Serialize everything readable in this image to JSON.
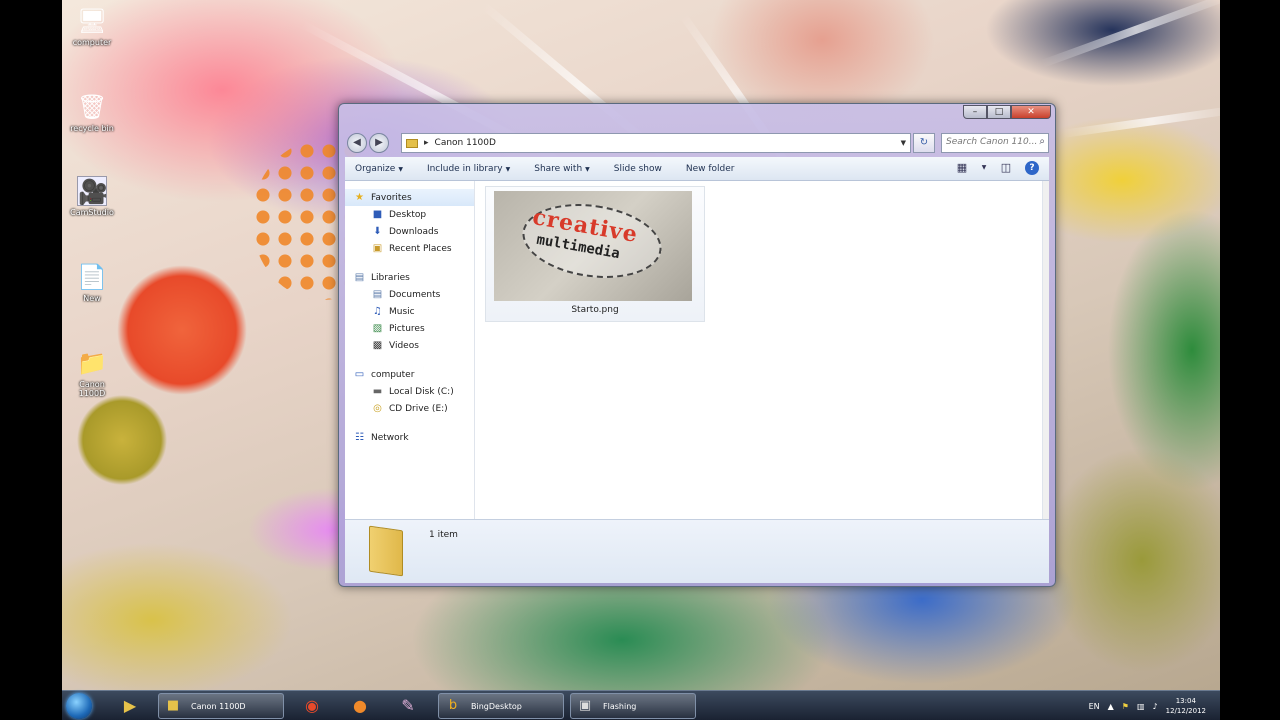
{
  "desktop": {
    "icons": [
      {
        "label": "computer",
        "icon": "computer-icon"
      },
      {
        "label": "recycle bin",
        "icon": "recycle-bin-icon"
      },
      {
        "label": "CamStudio",
        "icon": "camstudio-icon"
      },
      {
        "label": "New",
        "icon": "file-icon"
      },
      {
        "label": "Canon 1100D",
        "icon": "folder-icon"
      }
    ]
  },
  "window": {
    "address": {
      "path": "Canon 1100D"
    },
    "search": {
      "placeholder": "Search Canon 110..."
    },
    "toolbar": {
      "organize": "Organize",
      "include_in_library": "Include in library",
      "share_with": "Share with",
      "slide_show": "Slide show",
      "new_folder": "New folder"
    },
    "nav": {
      "favorites": "Favorites",
      "desktop": "Desktop",
      "downloads": "Downloads",
      "recent_places": "Recent Places",
      "libraries": "Libraries",
      "documents": "Documents",
      "music": "Music",
      "pictures": "Pictures",
      "videos": "Videos",
      "computer": "computer",
      "local_disk": "Local Disk (C:)",
      "cd_drive": "CD Drive (E:)",
      "network": "Network"
    },
    "files": [
      {
        "name": "Starto.png",
        "thumb_line1": "creative",
        "thumb_line2": "multimedia"
      }
    ],
    "details": {
      "count": "1 item"
    }
  },
  "taskbar": {
    "tasks": [
      {
        "label": "Canon 1100D"
      },
      {
        "label": "BingDesktop"
      },
      {
        "label": "Flashing"
      }
    ],
    "tray": {
      "lang": "EN",
      "time": "13:04",
      "date": "12/12/2012"
    }
  }
}
